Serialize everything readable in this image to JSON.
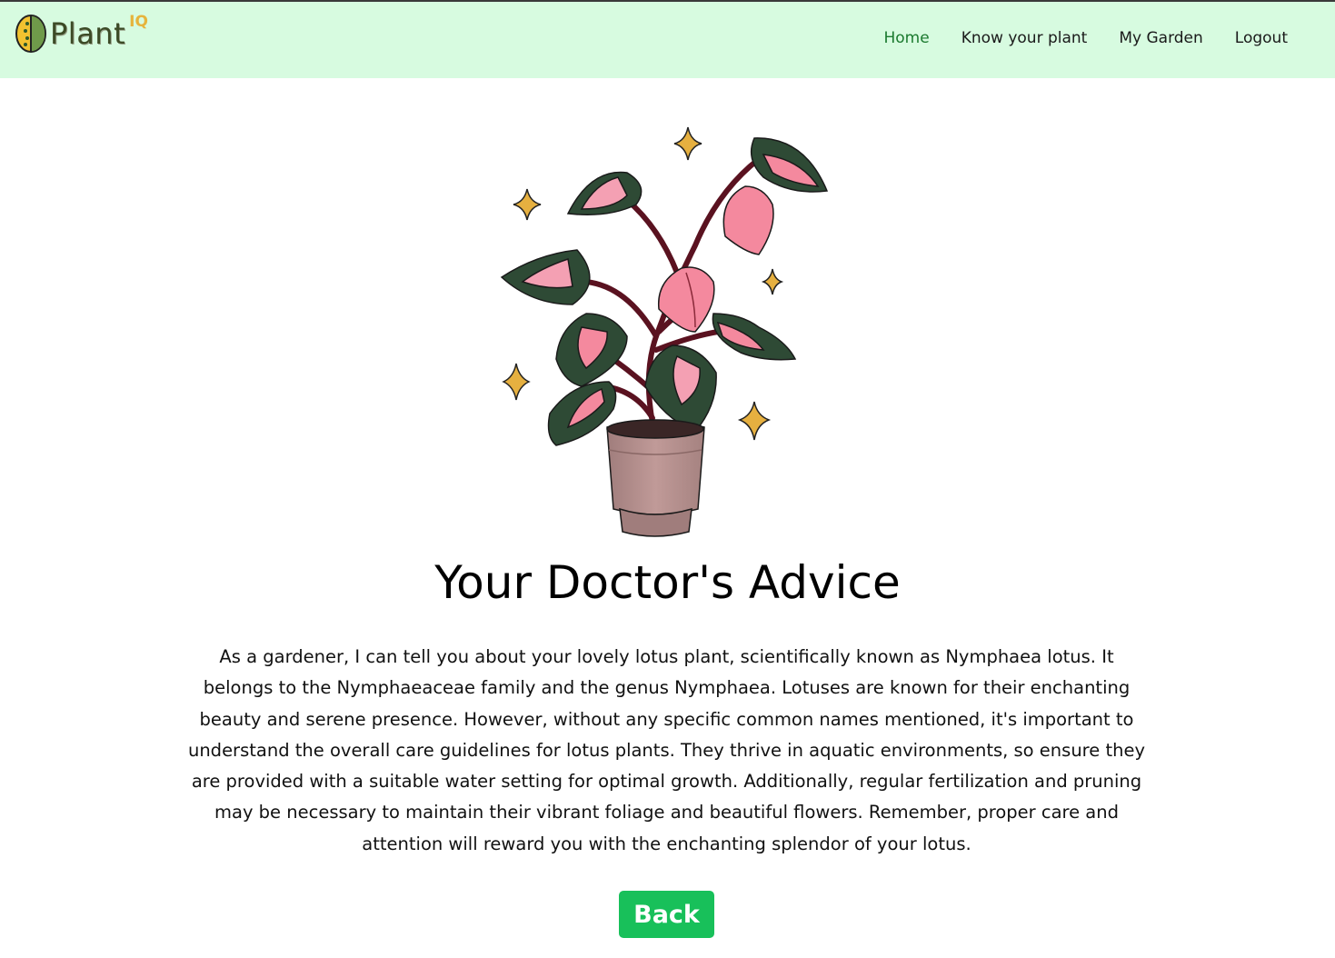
{
  "brand": {
    "name": "Plant",
    "suffix": "IQ",
    "logo_icon": "leaf-logo-icon"
  },
  "nav": {
    "items": [
      {
        "label": "Home",
        "active": true
      },
      {
        "label": "Know your plant",
        "active": false
      },
      {
        "label": "My Garden",
        "active": false
      },
      {
        "label": "Logout",
        "active": false
      }
    ]
  },
  "hero": {
    "illustration": "potted-pink-pothos-plant-with-sparkles"
  },
  "main": {
    "title": "Your Doctor's Advice",
    "advice": "As a gardener, I can tell you about your lovely lotus plant, scientifically known as Nymphaea lotus. It belongs to the Nymphaeaceae family and the genus Nymphaea. Lotuses are known for their enchanting beauty and serene presence. However, without any specific common names mentioned, it's important to understand the overall care guidelines for lotus plants. They thrive in aquatic environments, so ensure they are provided with a suitable water setting for optimal growth. Additionally, regular fertilization and pruning may be necessary to maintain their vibrant foliage and beautiful flowers. Remember, proper care and attention will reward you with the enchanting splendor of your lotus.",
    "back_label": "Back"
  },
  "colors": {
    "navbar_bg": "#d7fbe0",
    "active_link": "#1b7a2f",
    "button_bg": "#18c05a",
    "sparkle": "#e6b040",
    "leaf_dark": "#2e4a35",
    "leaf_pink": "#f4899e",
    "stem": "#5a1220",
    "pot": "#b08a88"
  }
}
